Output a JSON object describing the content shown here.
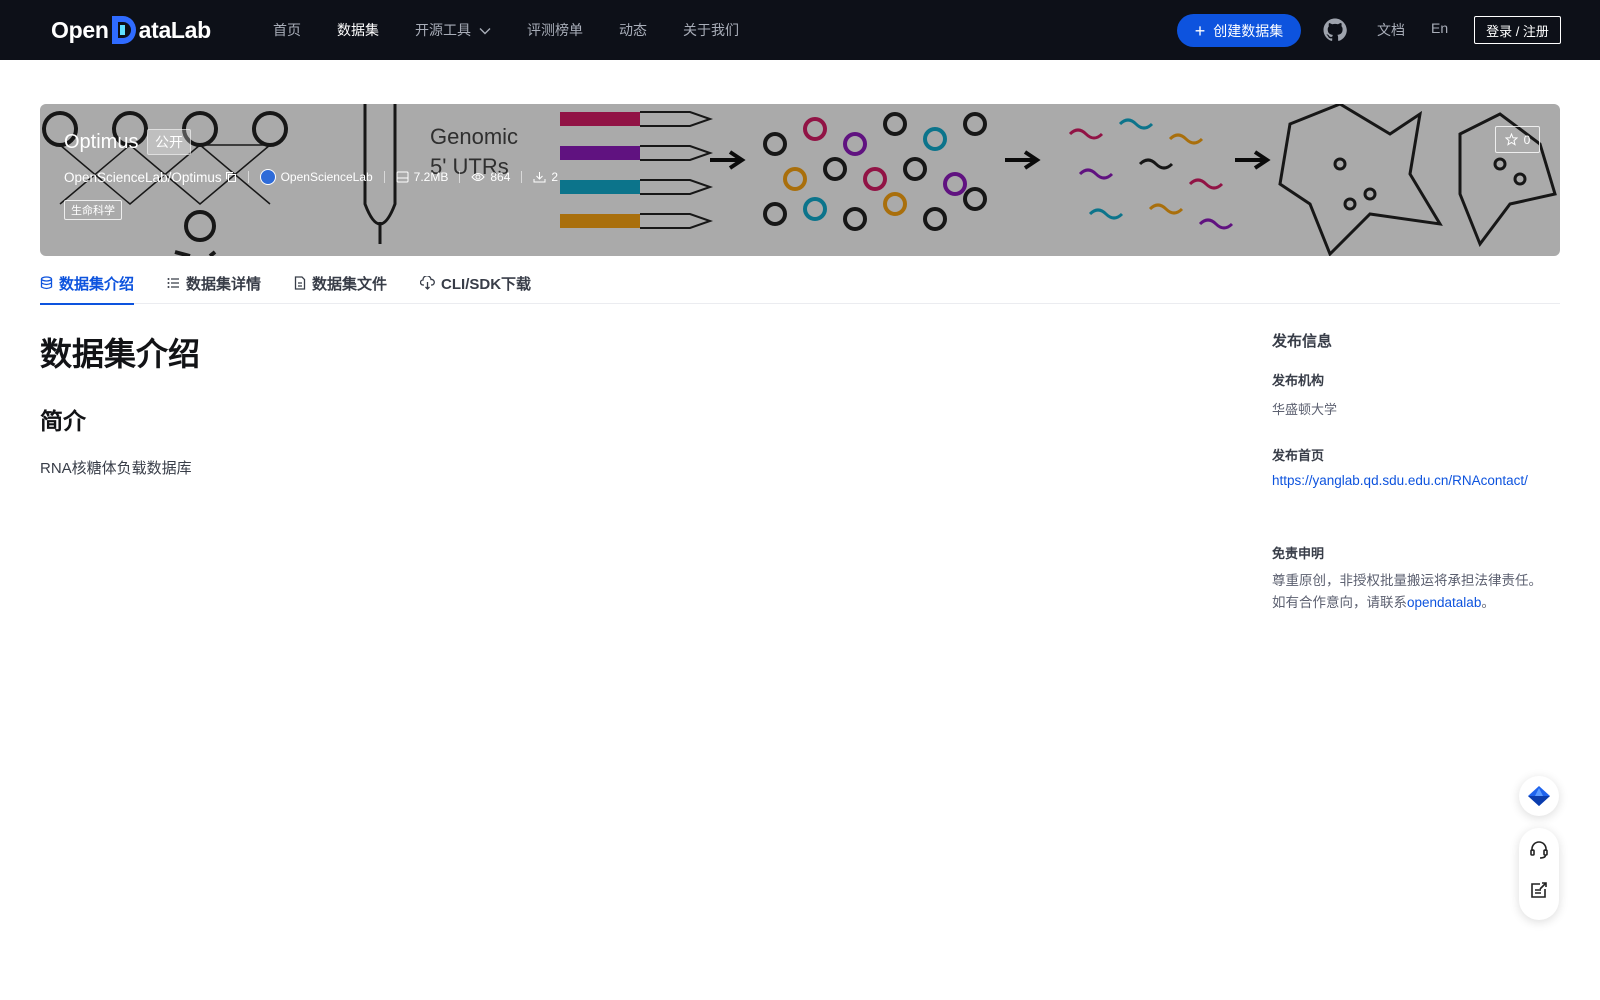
{
  "header": {
    "logo_text_left": "Open",
    "logo_text_right": "ataLab",
    "nav": [
      {
        "label": "首页",
        "active": false
      },
      {
        "label": "数据集",
        "active": true
      },
      {
        "label": "开源工具",
        "active": false,
        "has_dropdown": true
      },
      {
        "label": "评测榜单",
        "active": false
      },
      {
        "label": "动态",
        "active": false
      },
      {
        "label": "关于我们",
        "active": false
      }
    ],
    "create_label": "创建数据集",
    "github_icon": "github-icon",
    "docs_label": "文档",
    "lang_label": "En",
    "login_label": "登录 / 注册"
  },
  "dataset": {
    "name": "Optimus",
    "visibility": "公开",
    "path": "OpenScienceLab/Optimus",
    "org": "OpenScienceLab",
    "size": "7.2MB",
    "views": "864",
    "downloads": "2",
    "subject": "生命科学",
    "stars": "0"
  },
  "tabs": [
    {
      "label": "数据集介绍",
      "icon": "database-icon",
      "active": true
    },
    {
      "label": "数据集详情",
      "icon": "list-icon",
      "active": false
    },
    {
      "label": "数据集文件",
      "icon": "file-icon",
      "active": false
    },
    {
      "label": "CLI/SDK下载",
      "icon": "cloud-download-icon",
      "active": false
    }
  ],
  "content": {
    "title": "数据集介绍",
    "section_title": "简介",
    "description": "RNA核糖体负载数据库"
  },
  "side": {
    "heading": "发布信息",
    "publisher_label": "发布机构",
    "publisher": "华盛顿大学",
    "homepage_label": "发布首页",
    "homepage": "https://yanglab.qd.sdu.edu.cn/RNAcontact/",
    "disclaimer_label": "免责申明",
    "disclaimer_line1": "尊重原创，非授权批量搬运将承担法律责任。",
    "disclaimer_line2_prefix": "如有合作意向，请联系",
    "disclaimer_link": "opendatalab",
    "disclaimer_suffix": "。"
  },
  "floating": {
    "icons": [
      "diamond-icon",
      "headset-icon",
      "feedback-icon"
    ]
  },
  "colors": {
    "nav_bg": "#0d1018",
    "primary": "#0d53de",
    "text_dark": "#121316"
  }
}
